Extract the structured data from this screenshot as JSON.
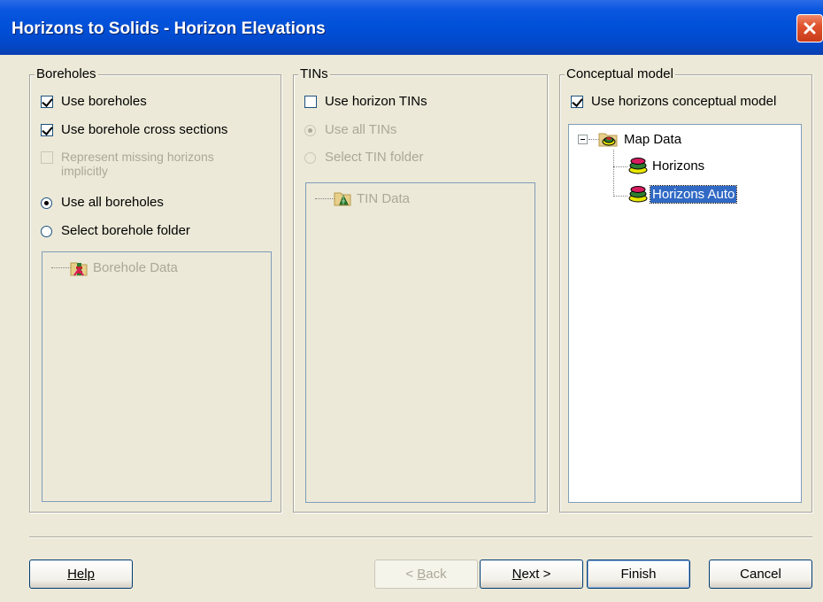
{
  "window": {
    "title": "Horizons to Solids - Horizon Elevations"
  },
  "boreholes": {
    "legend": "Boreholes",
    "use_boreholes": {
      "label": "Use boreholes",
      "checked": true
    },
    "use_cross_sections": {
      "label": "Use borehole cross sections",
      "checked": true
    },
    "represent_missing_line1": "Represent missing horizons",
    "represent_missing_line2": "implicitly",
    "use_all": {
      "label": "Use all boreholes",
      "selected": true
    },
    "select_folder": {
      "label": "Select borehole folder",
      "selected": false
    },
    "tree": {
      "root": "Borehole Data",
      "root_icon": "borehole-folder-icon"
    }
  },
  "tins": {
    "legend": "TINs",
    "use_horizon_tins": {
      "label": "Use horizon TINs",
      "checked": false
    },
    "use_all_tins": {
      "label": "Use all TINs",
      "selected": true
    },
    "select_tin_folder": {
      "label": "Select TIN folder",
      "selected": false
    },
    "tree": {
      "root": "TIN Data",
      "root_icon": "tin-folder-icon"
    }
  },
  "conceptual": {
    "legend": "Conceptual model",
    "use_conceptual": {
      "label": "Use horizons conceptual model",
      "checked": true
    },
    "tree": {
      "root": "Map Data",
      "children": [
        "Horizons",
        "Horizons Auto"
      ],
      "selected": "Horizons Auto"
    }
  },
  "buttons": {
    "help": "Help",
    "back_pre": "< ",
    "back_u": "B",
    "back_post": "ack",
    "next_u": "N",
    "next_post": "ext >",
    "finish": "Finish",
    "cancel": "Cancel"
  }
}
